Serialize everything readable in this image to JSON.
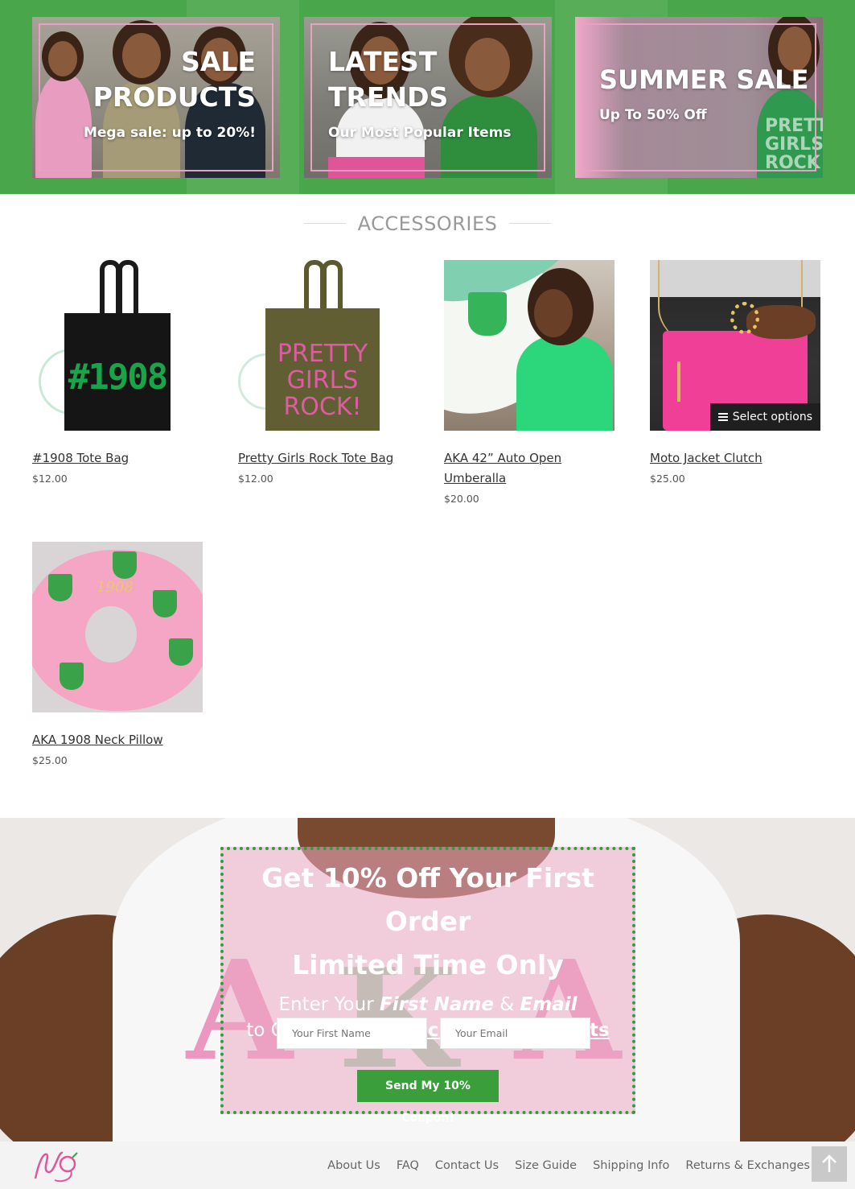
{
  "banners": [
    {
      "title_line1": "SALE",
      "title_line2": "PRODUCTS",
      "subtitle": "Mega sale: up to 20%!"
    },
    {
      "title_line1": "LATEST",
      "title_line2": "TRENDS",
      "subtitle": "Our Most Popular Items"
    },
    {
      "title": "SUMMER SALE",
      "subtitle": "Up To 50% Off"
    }
  ],
  "section": {
    "title": "ACCESSORIES"
  },
  "products": [
    {
      "name": "#1908 Tote Bag",
      "price": "$12.00",
      "image_text": "#1908"
    },
    {
      "name": "Pretty Girls Rock Tote Bag",
      "price": "$12.00",
      "image_text_1": "PRETTY",
      "image_text_2": "GIRLS",
      "image_text_3": "ROCK!"
    },
    {
      "name": "AKA 42” Auto Open Umberalla",
      "price": "$20.00"
    },
    {
      "name": "Moto Jacket Clutch",
      "price": "$25.00",
      "action_label": "Select options"
    },
    {
      "name": "AKA 1908 Neck Pillow",
      "price": "$25.00",
      "image_text": "1908"
    }
  ],
  "newsletter": {
    "headline_1": "Get 10% Off Your First Order",
    "headline_2": "Limited Time Only",
    "line1_a": "Enter Your ",
    "line1_b": "First Name",
    "line1_c": " & ",
    "line1_d": "Email",
    "line2_a": "to Get Access to ",
    "line2_b": "Exclusive Discounts",
    "first_name_placeholder": "Your First Name",
    "email_placeholder": "Your Email",
    "submit_label": "Send My 10% Coupon!"
  },
  "footer": {
    "links": [
      "About Us",
      "FAQ",
      "Contact Us",
      "Size Guide",
      "Shipping Info",
      "Returns & Exchanges"
    ]
  },
  "colors": {
    "brand_green": "#4aa64a",
    "brand_pink": "#e8a0c3",
    "cta_green": "#3a9e3a"
  }
}
